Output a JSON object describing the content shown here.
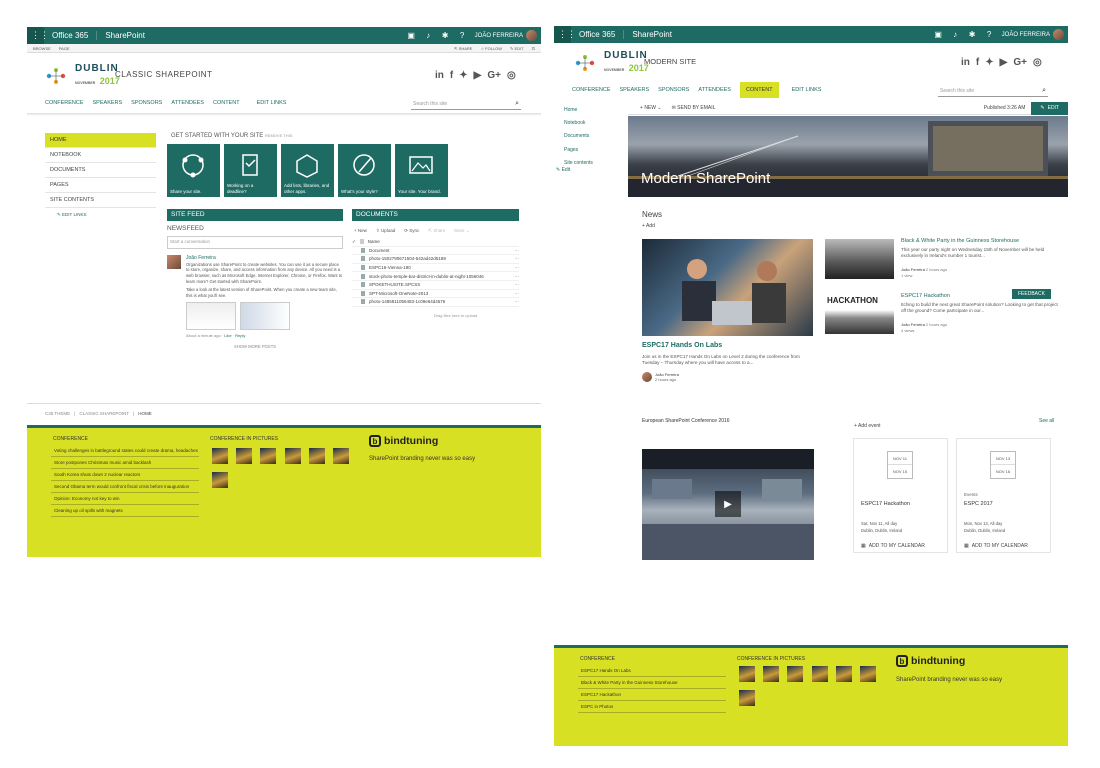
{
  "office_bar": {
    "app_launcher": "Office 365",
    "site": "SharePoint",
    "user_name": "JOÃO FERREIRA"
  },
  "classic": {
    "ribbon": {
      "browse": "BROWSE",
      "page": "PAGE",
      "share": "SHARE",
      "follow": "FOLLOW",
      "edit": "EDIT"
    },
    "logo": {
      "word": "DUBLIN",
      "year": "2017",
      "month": "NOVEMBER"
    },
    "site_title": "CLASSIC SHAREPOINT",
    "nav": [
      "CONFERENCE",
      "SPEAKERS",
      "SPONSORS",
      "ATTENDEES",
      "CONTENT"
    ],
    "edit_links": "EDIT LINKS",
    "search_placeholder": "Search this site",
    "left_nav": [
      "HOME",
      "NOTEBOOK",
      "DOCUMENTS",
      "PAGES",
      "SITE CONTENTS"
    ],
    "left_edit_links": "EDIT LINKS",
    "get_started": "GET STARTED WITH YOUR SITE",
    "remove_this": "REMOVE THIS",
    "tiles": [
      "Share your site.",
      "Working on a deadline?",
      "Add lists, libraries, and other apps.",
      "What's your style?",
      "Your site. Your brand."
    ],
    "site_feed": {
      "header": "SITE FEED",
      "newsfeed": "NEWSFEED",
      "start_conversation": "Start a conversation",
      "author": "João Ferreira",
      "post_text": "Organizations use SharePoint to create websites. You can use it as a secure place to store, organize, share, and access information from any device. All you need is a web browser, such as Microsoft Edge, Internet Explorer, Chrome, or Firefox. Want to learn more? Get started with SharePoint.",
      "post_text2": "Take a look at the latest version of SharePoint. When you create a new team site, this is what you'll see.",
      "post_meta": "About a minute ago",
      "like": "Like",
      "reply": "Reply",
      "show_more": "SHOW MORE POSTS"
    },
    "documents": {
      "header": "DOCUMENTS",
      "new": "New",
      "upload": "Upload",
      "sync": "Sync",
      "share": "Share",
      "more": "More",
      "name_col": "Name",
      "files": [
        "Document",
        "photo-1502790671504-542ad42d5189",
        "ESPC16-Vienna-180",
        "stock-photo-temple-bar-district-in-dublin-at-night-105604653",
        "SPOKETHUSITE.SPCSS",
        "SPT-Microsoft-OneNote-2013",
        "photo-1485811055483-1c09e64d4576"
      ],
      "drag_hint": "Drag files here to upload"
    },
    "breadcrumb": [
      "C35 THEME",
      "CLASSIC SHAREPOINT",
      "HOME"
    ],
    "footer": {
      "conference_head": "CONFERENCE",
      "links": [
        "Voting challenges in battleground states could create drama, headaches",
        "Store postpones Christmas music amid backlash",
        "South Korea shuts down 2 nuclear reactors",
        "Second Obama term would confront fiscal crisis before inauguration",
        "Opinion: Economy not key to win",
        "Cleaning up oil spills with magnets"
      ],
      "pictures_head": "CONFERENCE IN PICTURES",
      "brand": "bindtuning",
      "tagline": "SharePoint branding never was so easy"
    }
  },
  "modern": {
    "logo": {
      "word": "DUBLIN",
      "year": "2017",
      "month": "NOVEMBER"
    },
    "site_title": "MODERN SITE",
    "nav": [
      "CONFERENCE",
      "SPEAKERS",
      "SPONSORS",
      "ATTENDEES",
      "CONTENT"
    ],
    "edit_links": "EDIT LINKS",
    "search_placeholder": "Search this site",
    "left_nav": [
      "Home",
      "Notebook",
      "Documents",
      "Pages",
      "Site contents"
    ],
    "left_edit": "Edit",
    "cmd": {
      "new": "NEW",
      "send": "SEND BY EMAIL",
      "published": "Published 3:26 AM",
      "edit": "EDIT"
    },
    "hero_title": "Modern SharePoint",
    "news_head": "News",
    "add": "Add",
    "main_story": {
      "title": "ESPC17 Hands On Labs",
      "text": "Join us in the ESPC17 Hands On Labs on Level 2 during the conference from Tuesday – Thursday where you will have access to a...",
      "author": "João Ferreira",
      "time": "2 hours ago"
    },
    "stories": [
      {
        "title": "Black & White Party in the Guinness Storehouse",
        "text": "This year our party night on Wednesday 15th of November will be held exclusively in Ireland's number 1 tourist...",
        "author": "João Ferreira",
        "time": "2 hours ago",
        "views": "1 view"
      },
      {
        "title": "ESPC17 Hackathon",
        "text": "Itching to build the next great SharePoint solution? Looking to get that project off the ground? Come participate in our...",
        "author": "João Ferreira",
        "time": "2 hours ago",
        "views": "4 views"
      }
    ],
    "hackathon_text": "HACKATHON",
    "feedback": "FEEDBACK",
    "video_head": "European SharePoint Conference 2016",
    "add_event": "Add event",
    "see_all": "See all",
    "events": [
      {
        "date_from": "NOV 11",
        "date_to": "NOV 15",
        "category": "",
        "title": "ESPC17 Hackathon",
        "when": "Sat, Nov 11, All day",
        "where": "Dublin, Dublin, Ireland",
        "add": "ADD TO MY CALENDAR"
      },
      {
        "date_from": "NOV 13",
        "date_to": "NOV 16",
        "category": "Events",
        "title": "ESPC 2017",
        "when": "Mon, Nov 13, All day",
        "where": "Dublin, Dublin, Ireland",
        "add": "ADD TO MY CALENDAR"
      }
    ],
    "footer": {
      "conference_head": "CONFERENCE",
      "links": [
        "ESPC17 Hands On Labs",
        "Black & White Party in the Guinness Storehouse",
        "ESPC17 Hackathon",
        "ESPC in Photos"
      ],
      "pictures_head": "CONFERENCE IN PICTURES",
      "brand": "bindtuning",
      "tagline": "SharePoint branding never was so easy"
    }
  },
  "colors": {
    "teal": "#1e6b63",
    "lime": "#d8e023"
  }
}
